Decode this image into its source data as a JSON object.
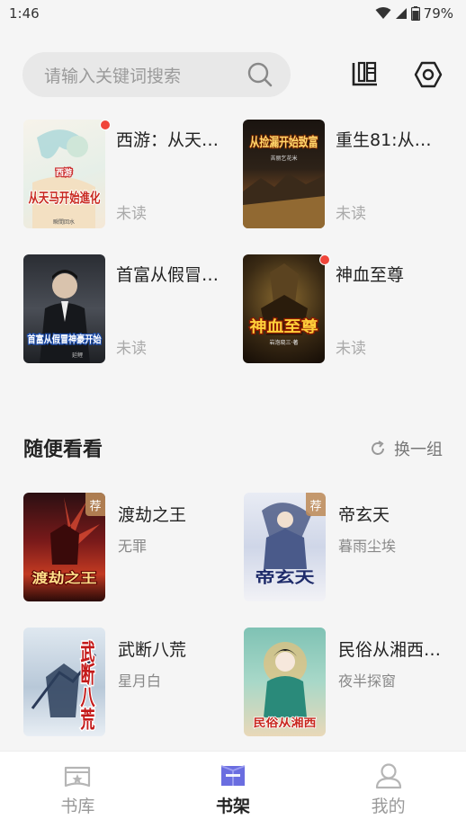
{
  "status_bar": {
    "time": "1:46",
    "battery": "79%"
  },
  "search": {
    "placeholder": "请输入关键词搜索"
  },
  "shelf": {
    "books": [
      {
        "title": "西游：从天…",
        "status": "未读",
        "unread_dot": true
      },
      {
        "title": "重生81:从…",
        "status": "未读",
        "unread_dot": false
      },
      {
        "title": "首富从假冒…",
        "status": "未读",
        "unread_dot": false
      },
      {
        "title": "神血至尊",
        "status": "未读",
        "unread_dot": true
      }
    ],
    "covers": [
      {
        "top": "西游",
        "main": "从天马开始進化",
        "sub": "瞬間回水"
      },
      {
        "main": "从捡漏开始致富",
        "sub": "苦丽乞花米"
      },
      {
        "main": "首富从假冒神豪开始",
        "sub": "延鲤"
      },
      {
        "main": "神血至尊",
        "sub": "岩泡晓三·著"
      }
    ]
  },
  "recommend": {
    "title": "随便看看",
    "refresh_label": "换一组",
    "tag": "荐",
    "books": [
      {
        "title": "渡劫之王",
        "author": "无罪",
        "tag": true,
        "cover_text": "渡劫之王"
      },
      {
        "title": "帝玄天",
        "author": "暮雨尘埃",
        "tag": true,
        "cover_text": "帝玄天"
      },
      {
        "title": "武断八荒",
        "author": "星月白",
        "tag": false,
        "cover_text": "武断八荒"
      },
      {
        "title": "民俗从湘西…",
        "author": "夜半探窗",
        "tag": false,
        "cover_text": "民俗从湘西"
      }
    ]
  },
  "tabs": [
    {
      "label": "书库",
      "icon": "library-icon",
      "active": false
    },
    {
      "label": "书架",
      "icon": "bookshelf-icon",
      "active": true
    },
    {
      "label": "我的",
      "icon": "profile-icon",
      "active": false
    }
  ],
  "colors": {
    "unread_dot": "#f0453a",
    "tab_active_icon": "#6a6de0",
    "tab_inactive_icon": "#b5b5b5"
  }
}
